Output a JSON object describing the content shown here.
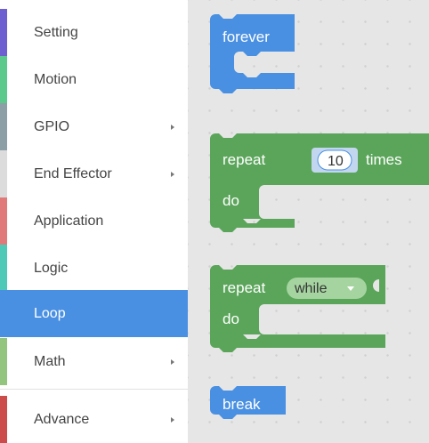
{
  "categories": [
    {
      "label": "Setting",
      "color": "#6e5fd0",
      "has_submenu": false
    },
    {
      "label": "Motion",
      "color": "#5bc98b",
      "has_submenu": false
    },
    {
      "label": "GPIO",
      "color": "#8c9fa6",
      "has_submenu": true
    },
    {
      "label": "End Effector",
      "color": "#dcdcdc",
      "has_submenu": true
    },
    {
      "label": "Application",
      "color": "#e07a7a",
      "has_submenu": false
    },
    {
      "label": "Logic",
      "color": "#4ec9b8",
      "has_submenu": false
    },
    {
      "label": "Loop",
      "color": "#4a90e2",
      "has_submenu": false,
      "selected": true
    },
    {
      "label": "Math",
      "color": "#93c57e",
      "has_submenu": true
    },
    {
      "label": "Advance",
      "color": "#cc4c4c",
      "has_submenu": true
    }
  ],
  "blocks": {
    "forever": {
      "label": "forever",
      "color": "#4a90e2"
    },
    "repeat_times": {
      "label": "repeat",
      "count": "10",
      "suffix": "times",
      "do_label": "do",
      "color": "#5ba55b"
    },
    "repeat_while": {
      "label": "repeat",
      "mode": "while",
      "do_label": "do",
      "color": "#5ba55b"
    },
    "break": {
      "label": "break",
      "color": "#4a90e2"
    }
  }
}
